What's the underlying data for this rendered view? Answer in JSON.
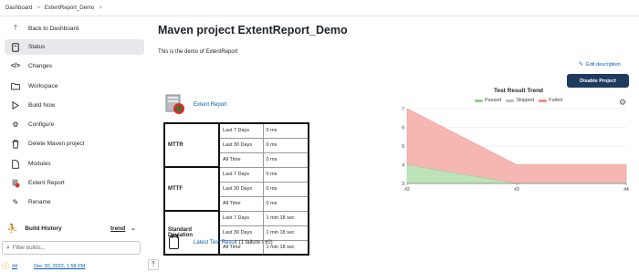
{
  "breadcrumb": {
    "items": [
      "Dashboard",
      "ExtentReport_Demo"
    ],
    "separator": ">"
  },
  "sidebar": {
    "items": [
      {
        "label": "Back to Dashboard",
        "icon": "arrow-up-icon",
        "active": false
      },
      {
        "label": "Status",
        "icon": "document-icon",
        "active": true
      },
      {
        "label": "Changes",
        "icon": "code-icon",
        "active": false
      },
      {
        "label": "Workspace",
        "icon": "folder-icon",
        "active": false
      },
      {
        "label": "Build Now",
        "icon": "play-icon",
        "active": false
      },
      {
        "label": "Configure",
        "icon": "gear-icon",
        "active": false
      },
      {
        "label": "Delete Maven project",
        "icon": "trash-icon",
        "active": false
      },
      {
        "label": "Modules",
        "icon": "document-icon",
        "active": false
      },
      {
        "label": "Extent Report",
        "icon": "extent-report-icon",
        "active": false
      },
      {
        "label": "Rename",
        "icon": "pencil-icon",
        "active": false
      }
    ],
    "build_history": {
      "label": "Build History",
      "trend_label": "trend"
    },
    "filter_placeholder": "Filter builds...",
    "build": {
      "number": "#4",
      "date": "Dec 30, 2022, 1:58 PM"
    }
  },
  "main": {
    "title": "Maven project ExtentReport_Demo",
    "description": "This is the demo of ExtentReport",
    "edit_description": "Edit description",
    "disable_button": "Disable Project",
    "extent_report_link": "Extent Report",
    "latest_test_result": {
      "link": "Latest Test Result",
      "suffix": "(1 failure / ±0)"
    }
  },
  "metrics": [
    {
      "group": "MTTR",
      "rows": [
        [
          "Last 7 Days",
          "0 ms"
        ],
        [
          "Last 30 Days",
          "0 ms"
        ],
        [
          "All Time",
          "0 ms"
        ]
      ]
    },
    {
      "group": "MTTF",
      "rows": [
        [
          "Last 7 Days",
          "0 ms"
        ],
        [
          "Last 30 Days",
          "0 ms"
        ],
        [
          "All Time",
          "0 ms"
        ]
      ]
    },
    {
      "group": "Standard Deviation",
      "rows": [
        [
          "Last 7 Days",
          "1 min 18 sec"
        ],
        [
          "Last 30 Days",
          "1 min 18 sec"
        ],
        [
          "All Time",
          "1 min 18 sec"
        ]
      ]
    }
  ],
  "chart_data": {
    "type": "area",
    "title": "Test Result Trend",
    "x": [
      "#2",
      "#3",
      "#4"
    ],
    "series": [
      {
        "name": "Passed",
        "values": [
          4,
          3,
          3
        ],
        "color": "#a9dba0"
      },
      {
        "name": "Skipped",
        "values": [
          0,
          0,
          0
        ],
        "color": "#c8c8c8"
      },
      {
        "name": "Failed",
        "values": [
          3,
          1,
          1
        ],
        "color": "#f4a3a0"
      }
    ],
    "yticks": [
      3,
      4,
      5,
      6,
      7
    ],
    "ylim": [
      3,
      7
    ],
    "legend": "top",
    "grid": true
  }
}
